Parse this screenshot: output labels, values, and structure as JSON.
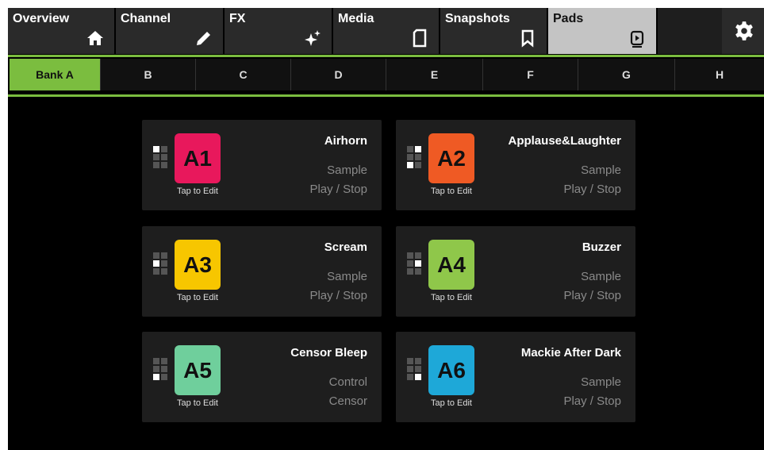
{
  "nav": {
    "tabs": [
      {
        "label": "Overview",
        "icon": "home-icon"
      },
      {
        "label": "Channel",
        "icon": "pencil-icon"
      },
      {
        "label": "FX",
        "icon": "sparkle-icon"
      },
      {
        "label": "Media",
        "icon": "sd-card-icon"
      },
      {
        "label": "Snapshots",
        "icon": "bookmark-icon"
      },
      {
        "label": "Pads",
        "icon": "pad-play-icon"
      }
    ],
    "active_tab": "Pads",
    "settings_icon": "gear-icon"
  },
  "banks": [
    "Bank A",
    "B",
    "C",
    "D",
    "E",
    "F",
    "G",
    "H"
  ],
  "active_bank": "Bank A",
  "tap_label": "Tap to Edit",
  "pads": [
    {
      "id": "A1",
      "name": "Airhorn",
      "type": "Sample",
      "action": "Play / Stop",
      "color": "#e8185c"
    },
    {
      "id": "A2",
      "name": "Applause&Laughter",
      "type": "Sample",
      "action": "Play / Stop",
      "color": "#ef5a24"
    },
    {
      "id": "A3",
      "name": "Scream",
      "type": "Sample",
      "action": "Play / Stop",
      "color": "#f7c600"
    },
    {
      "id": "A4",
      "name": "Buzzer",
      "type": "Sample",
      "action": "Play / Stop",
      "color": "#8fc74a"
    },
    {
      "id": "A5",
      "name": "Censor Bleep",
      "type": "Control",
      "action": "Censor",
      "color": "#6fcf9c"
    },
    {
      "id": "A6",
      "name": "Mackie After Dark",
      "type": "Sample",
      "action": "Play / Stop",
      "color": "#1ea8d8"
    }
  ],
  "colors": {
    "accent": "#7bbd3f",
    "active_tab_bg": "#c4c4c4"
  }
}
